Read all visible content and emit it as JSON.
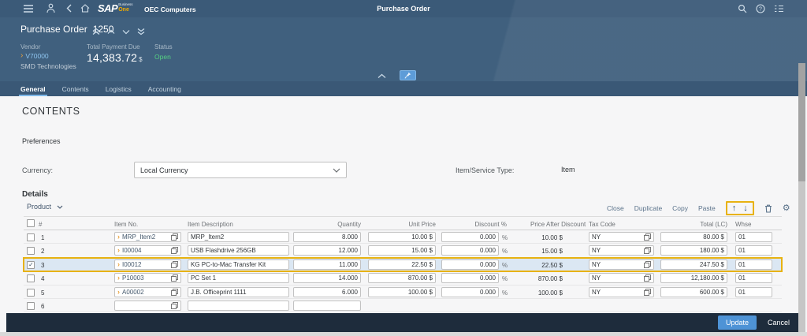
{
  "colors": {
    "header_bg": "#40607e",
    "tabbar_bg": "#3a5876",
    "footer_bg": "#1e2c3c",
    "accent_blue": "#4e93d6",
    "highlight_yellow": "#e8b211",
    "status_green": "#55cf83",
    "vendor_link_blue": "#8ec5ef",
    "sap_gold": "#f0ab00"
  },
  "topbar": {
    "logo_sap": "SAP",
    "logo_business": "Business",
    "logo_one": "One",
    "company": "OEC Computers",
    "title": "Purchase Order"
  },
  "hero": {
    "title": "Purchase Order",
    "doc_number": "1250",
    "vendor": {
      "label": "Vendor",
      "code": "V70000",
      "name": "SMD Technologies"
    },
    "total": {
      "label": "Total Payment Due",
      "value": "14,383.72",
      "currency": "$"
    },
    "status": {
      "label": "Status",
      "value": "Open"
    }
  },
  "tabs": [
    {
      "label": "General"
    },
    {
      "label": "Contents"
    },
    {
      "label": "Logistics"
    },
    {
      "label": "Accounting"
    }
  ],
  "contents": {
    "heading": "CONTENTS",
    "preferences_label": "Preferences",
    "currency_label": "Currency:",
    "currency_value": "Local Currency",
    "item_service_label": "Item/Service Type:",
    "item_service_value": "Item",
    "details_label": "Details",
    "product_label": "Product"
  },
  "toolbar": {
    "close": "Close",
    "duplicate": "Duplicate",
    "copy": "Copy",
    "paste": "Paste"
  },
  "table": {
    "columns": {
      "num": "#",
      "item_no": "Item No.",
      "description": "Item Description",
      "quantity": "Quantity",
      "unit_price": "Unit Price",
      "discount": "Discount %",
      "price_after_discount": "Price After Discount",
      "tax_code": "Tax Code",
      "total": "Total (LC)",
      "whse": "Whse"
    },
    "percent": "%",
    "rows": [
      {
        "num": "1",
        "item_no": "MRP_Item2",
        "description": "MRP_Item2",
        "quantity": "8.000",
        "unit_price": "10.00 $",
        "discount": "0.000",
        "price_after_discount": "10.00 $",
        "tax_code": "NY",
        "total": "80.00 $",
        "whse": "01"
      },
      {
        "num": "2",
        "item_no": "I00004",
        "description": "USB Flashdrive 256GB",
        "quantity": "12.000",
        "unit_price": "15.00 $",
        "discount": "0.000",
        "price_after_discount": "15.00 $",
        "tax_code": "NY",
        "total": "180.00 $",
        "whse": "01"
      },
      {
        "num": "3",
        "item_no": "I00012",
        "description": "KG PC-to-Mac Transfer Kit",
        "quantity": "11.000",
        "unit_price": "22.50 $",
        "discount": "0.000",
        "price_after_discount": "22.50 $",
        "tax_code": "NY",
        "total": "247.50 $",
        "whse": "01",
        "selected": true,
        "checked": true
      },
      {
        "num": "4",
        "item_no": "P10003",
        "description": "PC Set 1",
        "quantity": "14.000",
        "unit_price": "870.00 $",
        "discount": "0.000",
        "price_after_discount": "870.00 $",
        "tax_code": "NY",
        "total": "12,180.00 $",
        "whse": "01"
      },
      {
        "num": "5",
        "item_no": "A00002",
        "description": "J.B. Officeprint 1111",
        "quantity": "6.000",
        "unit_price": "100.00 $",
        "discount": "0.000",
        "price_after_discount": "100.00 $",
        "tax_code": "NY",
        "total": "600.00 $",
        "whse": "01"
      },
      {
        "num": "6"
      }
    ]
  },
  "footer": {
    "update": "Update",
    "cancel": "Cancel"
  }
}
